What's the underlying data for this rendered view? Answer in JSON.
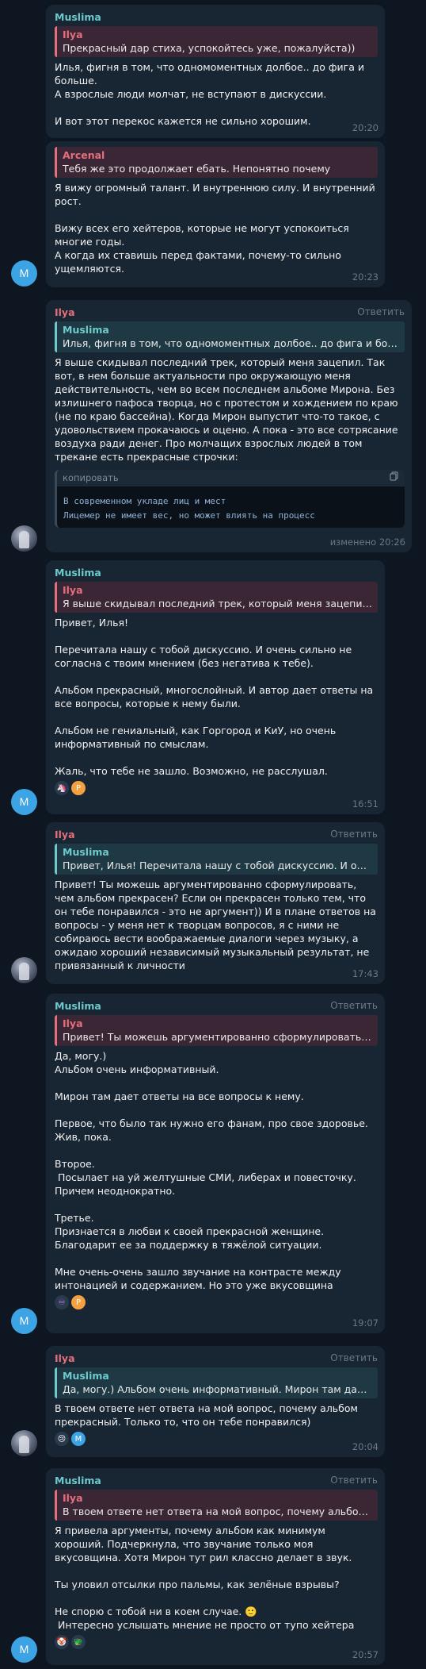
{
  "reply_label": "Ответить",
  "messages": [
    {
      "sender": "Muslima",
      "quote_name": "Ilya",
      "quote_text": "Прекрасный дар стиха, успокойтесь уже, пожалуйста))",
      "text": "Илья, фигня в том, что одномоментных долбое.. до фига и больше.\nА взрослые люди молчат, не вступают в дискуссии.\n\nИ вот этот перекос кажется не сильно хорошим.",
      "time": "20:20"
    },
    {
      "sender": "",
      "quote_name": "Arcenal",
      "quote_text": "Тебя же это продолжает ебать. Непонятно почему",
      "text": "Я вижу огромный талант. И внутреннюю силу. И внутренний рост.\n\nВижу всех его хейтеров, которые не могут успокоиться многие годы.\nА когда их ставишь перед фактами, почему-то сильно ущемляются.",
      "time": "20:23",
      "avatar": "M"
    },
    {
      "sender": "Ilya",
      "quote_name": "Muslima",
      "quote_text": "Илья, фигня в том, что одномоментных долбое.. до фига и больше...",
      "text": "Я выше скидывал последний трек, который меня зацепил. Так вот, в нем больше актуальности про окружающую меня действительность, чем во всем последнем альбоме Мирона. Без излишнего пафоса творца, но с протестом и хождением по краю (не по краю бассейна). Когда Мирон выпустит что-то такое, с удовольствием прокачаюсь и оценю. А пока - это все сотрясание воздуха ради денег. Про молчащих взрослых людей в том трекане есть прекрасные строчки:",
      "code_label": "копировать",
      "code_icon": "copy-icon",
      "code_lines": [
        "В современном укладе лиц и мест",
        "Лицемер не имеет вес, но может влиять на процесс"
      ],
      "time": "изменено 20:26"
    },
    {
      "sender": "Muslima",
      "quote_name": "Ilya",
      "quote_text": "Я выше скидывал последний трек, который меня зацепил. Та...",
      "text": "Привет, Илья!\n\nПеречитала нашу с тобой дискуссию. И очень сильно не согласна с твоим мнением (без негатива к тебе).\n\nАльбом прекрасный, многослойный. И автор дает ответы на все вопросы, которые к нему были.\n\nАльбом не гениальный, как Горгород и КиУ, но очень информативный по смыслам.\n\nЖаль, что тебе не зашло. Возможно, не расслушал.",
      "time": "16:51",
      "avatar": "M"
    },
    {
      "sender": "Ilya",
      "quote_name": "Muslima",
      "quote_text": "Привет, Илья!  Перечитала нашу с тобой дискуссию. И очень...",
      "text": "Привет! Ты можешь аргументированно сформулировать, чем альбом прекрасен? Если он прекрасен только тем, что он тебе понравился - это не аргумент)) И в плане ответов на вопросы - у меня нет к творцам вопросов, я с ними не собираюсь вести воображаемые диалоги через музыку, а ожидаю хороший независимый музыкальный результат, не привязанный к личности",
      "time": "17:43"
    },
    {
      "sender": "Muslima",
      "quote_name": "Ilya",
      "quote_text": "Привет! Ты можешь аргументированно сформулировать, че...",
      "text": "Да, могу.)\nАльбом очень информативный.\n\nМирон там дает ответы на все вопросы к нему.\n\nПервое, что было так нужно его фанам, про свое здоровье. Жив, пока.\n\nВторое.\n Посылает на уй желтушные СМИ, либерах и повесточку.\nПричем неоднократно.\n\nТретье.\nПризнается в любви к своей прекрасной женщине. Благодарит ее за поддержку в тяжёлой ситуации.\n\nМне очень-очень зашло звучание на контрасте между интонацией и содержанием. Но это уже вкусовщина",
      "time": "19:07",
      "avatar": "M"
    },
    {
      "sender": "Ilya",
      "quote_name": "Muslima",
      "quote_text": "Да, могу.) Альбом очень информативный.  Мирон там дает о...",
      "text": "В твоем ответе нет ответа на мой вопрос, почему альбом прекрасный. Только то, что он тебе понравился)",
      "time": "20:04"
    },
    {
      "sender": "Muslima",
      "quote_name": "Ilya",
      "quote_text": "В твоем ответе нет ответа на мой вопрос, почему альбом пр...",
      "text": "Я привела аргументы, почему альбом как минимум хороший. Подчеркнула, что звучание только моя вкусовщина. Хотя Мирон тут рил классно делает в звук.\n\nТы уловил отсылки про пальмы, как зелёные взрывы?\n\nНе спорю с тобой ни в коем случае. 🙂\n Интересно услышать мнение не просто от тупо хейтера",
      "time": "20:57",
      "avatar": "M"
    }
  ],
  "reactions": {
    "r4": [
      "🦄",
      "P"
    ],
    "r6": [
      "♾",
      "P"
    ],
    "r7": [
      "😢",
      "M"
    ],
    "r8": [
      "🤡",
      "🐲"
    ]
  },
  "colors": {
    "background": "#0e1621",
    "bubble": "#182533",
    "muslima": "#6ec9cb",
    "ilya": "#e56f7d",
    "avatar_m": "#3ca3e4"
  }
}
